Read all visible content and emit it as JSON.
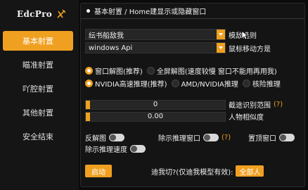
{
  "brand": {
    "name": "EdcPro"
  },
  "sidebar": {
    "items": [
      {
        "label": "基本射置",
        "active": true
      },
      {
        "label": "瞄准射置",
        "active": false
      },
      {
        "label": "吖腔射置",
        "active": false
      },
      {
        "label": "其他射置",
        "active": false
      },
      {
        "label": "安全结束",
        "active": false
      }
    ]
  },
  "header": {
    "title": "基本射置 / Home建显示或隐藏窗口"
  },
  "enemy_select": {
    "value": "纭书船敌我",
    "label": "模敌选则"
  },
  "mouse_select": {
    "value": "windows Api",
    "label": "鼠标移动方是"
  },
  "capture": {
    "option1": "窗口解图(推荐)",
    "option2": "全屏解图(速度较慢 窗口不能用再用我)",
    "selected": "option1"
  },
  "inference": {
    "option1": "NVIDIA高速推理(推荐)",
    "option2": "AMD/NVIDIA推理",
    "option3": "核险推理",
    "selected": "option1"
  },
  "range": {
    "value": "0",
    "label": "截途识别范围",
    "help": "(?)"
  },
  "similarity": {
    "value": "0.00",
    "label": "人物相似度"
  },
  "toggles": {
    "reverse_label": "反解图",
    "show_window_label": "除示推理窗口",
    "show_window_help": "(?)",
    "topmost_label": "置顶窗口",
    "show_speed_label": "除示推理速度"
  },
  "footer": {
    "start_label": "启动",
    "question": "迪我切?(仅迪我模型有效):",
    "all_label": "全部人"
  },
  "colors": {
    "accent": "#f0a020",
    "panel": "#141414",
    "sidebar": "#151515"
  }
}
